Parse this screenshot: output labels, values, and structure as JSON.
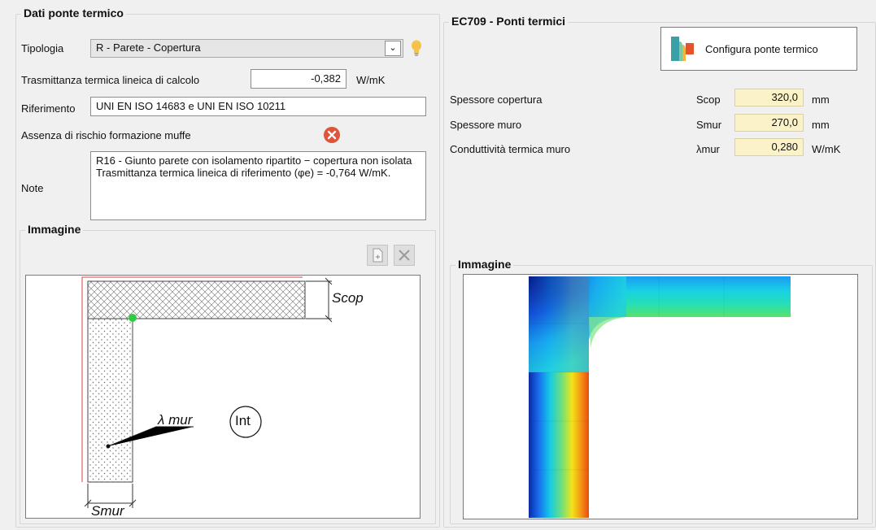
{
  "left_panel": {
    "title": "Dati ponte termico",
    "tipologia_label": "Tipologia",
    "tipologia_value": "R - Parete - Copertura",
    "trasmittanza_label": "Trasmittanza termica lineica di calcolo",
    "trasmittanza_value": "-0,382",
    "trasmittanza_unit": "W/mK",
    "riferimento_label": "Riferimento",
    "riferimento_value": "UNI EN ISO 14683 e UNI EN ISO 10211",
    "muffe_label": "Assenza di rischio formazione muffe",
    "note_label": "Note",
    "note_text": "R16 - Giunto parete con isolamento ripartito − copertura non isolata\nTrasmittanza termica lineica di riferimento (φe) = -0,764 W/mK.",
    "image_group_title": "Immagine",
    "diagram": {
      "scop_label": "Scop",
      "lambda_label": "λ mur",
      "int_label": "Int",
      "smur_label": "Smur"
    }
  },
  "right_panel": {
    "title": "EC709 - Ponti termici",
    "configure_button": "Configura ponte termico",
    "params": [
      {
        "label": "Spessore copertura",
        "symbol": "Scop",
        "value": "320,0",
        "unit": "mm"
      },
      {
        "label": "Spessore muro",
        "symbol": "Smur",
        "value": "270,0",
        "unit": "mm"
      },
      {
        "label": "Conduttività termica muro",
        "symbol": "λmur",
        "value": "0,280",
        "unit": "W/mK"
      }
    ],
    "image_group_title": "Immagine"
  }
}
